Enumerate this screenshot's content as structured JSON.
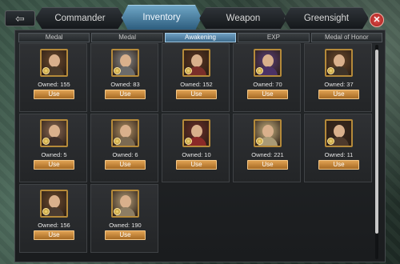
{
  "topbar": {
    "back_icon": "back-arrow-icon",
    "tabs": [
      {
        "label": "Commander"
      },
      {
        "label": "Inventory"
      },
      {
        "label": "Weapon"
      },
      {
        "label": "Greensight"
      }
    ],
    "close_icon": "close-icon",
    "close_glyph": "✕"
  },
  "subtabs": [
    {
      "label": "Medal"
    },
    {
      "label": "Medal"
    },
    {
      "label": "Awakening"
    },
    {
      "label": "EXP"
    },
    {
      "label": "Medal of Honor"
    }
  ],
  "items": [
    {
      "owned": "Owned: 155",
      "use": "Use",
      "tone": "#6a4a2e",
      "body": "#4a3a2a"
    },
    {
      "owned": "Owned: 83",
      "use": "Use",
      "tone": "#8a8a8a",
      "body": "#6b6b6b"
    },
    {
      "owned": "Owned: 152",
      "use": "Use",
      "tone": "#5a3522",
      "body": "#7a2f2a"
    },
    {
      "owned": "Owned: 70",
      "use": "Use",
      "tone": "#5a3f7a",
      "body": "#4b3266"
    },
    {
      "owned": "Owned: 37",
      "use": "Use",
      "tone": "#6b4a2c",
      "body": "#3e3328"
    },
    {
      "owned": "Owned: 5",
      "use": "Use",
      "tone": "#8c6b55",
      "body": "#3d2f2a"
    },
    {
      "owned": "Owned: 6",
      "use": "Use",
      "tone": "#b49468",
      "body": "#7b6a52"
    },
    {
      "owned": "Owned: 10",
      "use": "Use",
      "tone": "#6b2e2a",
      "body": "#8a2a28"
    },
    {
      "owned": "Owned: 221",
      "use": "Use",
      "tone": "#cbb583",
      "body": "#a99a76"
    },
    {
      "owned": "Owned: 11",
      "use": "Use",
      "tone": "#3a2a20",
      "body": "#4e3a2c"
    },
    {
      "owned": "Owned: 156",
      "use": "Use",
      "tone": "#6a4a2e",
      "body": "#4a3b30"
    },
    {
      "owned": "Owned: 190",
      "use": "Use",
      "tone": "#b7a07a",
      "body": "#8d7d63"
    }
  ],
  "colors": {
    "accent_tab": "#4a84a8",
    "use_button": "#c4853a",
    "portrait_frame": "#b58a3a"
  }
}
